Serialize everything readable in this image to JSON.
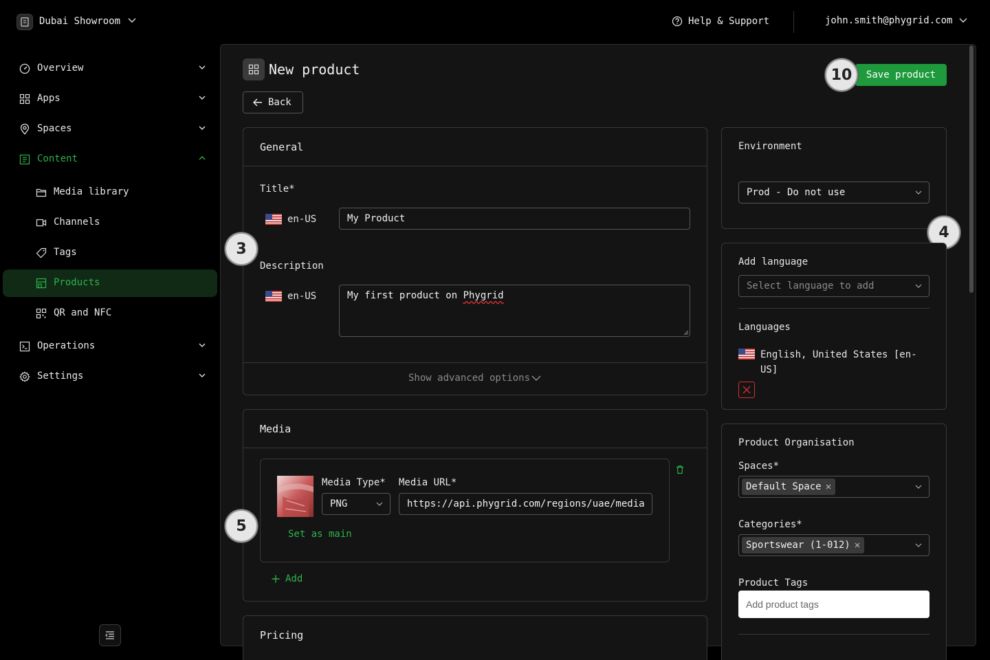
{
  "topbar": {
    "workspace_name": "Dubai Showroom",
    "help_label": "Help & Support",
    "user_email": "john.smith@phygrid.com"
  },
  "sidebar": {
    "items": [
      {
        "label": "Overview",
        "icon": "dashboard-icon"
      },
      {
        "label": "Apps",
        "icon": "grid-icon"
      },
      {
        "label": "Spaces",
        "icon": "location-pin-icon"
      },
      {
        "label": "Content",
        "icon": "content-icon",
        "expanded": true
      },
      {
        "label": "Media library",
        "icon": "folder-icon"
      },
      {
        "label": "Channels",
        "icon": "video-icon"
      },
      {
        "label": "Tags",
        "icon": "tag-icon"
      },
      {
        "label": "Products",
        "icon": "store-icon",
        "active": true
      },
      {
        "label": "QR and NFC",
        "icon": "qr-icon"
      },
      {
        "label": "Operations",
        "icon": "terminal-icon"
      },
      {
        "label": "Settings",
        "icon": "gear-icon"
      }
    ]
  },
  "page": {
    "title": "New product",
    "back_label": "Back",
    "save_label": "Save product"
  },
  "badges": {
    "save": "10",
    "general": "3",
    "side": "4",
    "media": "5"
  },
  "general": {
    "title": "General",
    "title_label": "Title",
    "required_mark": "*",
    "locale": "en-US",
    "title_value": "My Product",
    "description_label": "Description",
    "description_value_start": "My first product on ",
    "description_value_misspelled": "Phygrid",
    "advanced_label": "Show advanced options"
  },
  "media": {
    "title": "Media",
    "type_label": "Media Type",
    "url_label": "Media URL",
    "type_value": "PNG",
    "url_value": "https://api.phygrid.com/regions/uae/media",
    "set_main_label": "Set as main",
    "add_label": "Add"
  },
  "pricing": {
    "title": "Pricing"
  },
  "environment": {
    "title": "Environment",
    "value": "Prod - Do not use"
  },
  "language": {
    "add_title": "Add language",
    "add_placeholder": "Select language to add",
    "languages_title": "Languages",
    "language_line1": "English, United States [en-",
    "language_line2": "US]"
  },
  "organisation": {
    "title": "Product Organisation",
    "spaces_label": "Spaces",
    "spaces_chip": "Default Space",
    "categories_label": "Categories",
    "categories_chip": "Sportswear (1-012)",
    "tags_label": "Product Tags",
    "tags_placeholder": "Add product tags"
  },
  "colors": {
    "accent": "#1e9a3d",
    "accent_text": "#2db24a",
    "danger": "#d43030"
  }
}
